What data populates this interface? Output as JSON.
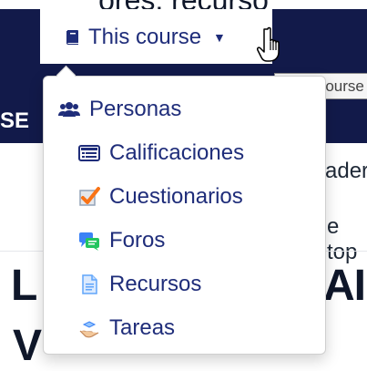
{
  "background": {
    "top_text": "ores, recurso",
    "se_text": "SE",
    "right_fragment_1": "ader",
    "right_fragment_2": "e top",
    "big_left": "L",
    "big_right": "AI",
    "big_bottom": "V"
  },
  "header": {
    "course_tab_label": "This course",
    "course_tab_icon": "book-icon"
  },
  "tooltip": {
    "text": "This course"
  },
  "dropdown": {
    "items": [
      {
        "label": "Personas",
        "icon": "users-icon",
        "indent": false
      },
      {
        "label": "Calificaciones",
        "icon": "gradebook-icon",
        "indent": true
      },
      {
        "label": "Cuestionarios",
        "icon": "quiz-check-icon",
        "indent": true
      },
      {
        "label": "Foros",
        "icon": "forum-icon",
        "indent": true
      },
      {
        "label": "Recursos",
        "icon": "resource-file-icon",
        "indent": true
      },
      {
        "label": "Tareas",
        "icon": "assignment-hand-icon",
        "indent": true
      }
    ]
  },
  "colors": {
    "accent": "#1f2d7a",
    "dark_nav": "#121a4a",
    "tooltip_bg": "#f5f5f5"
  }
}
